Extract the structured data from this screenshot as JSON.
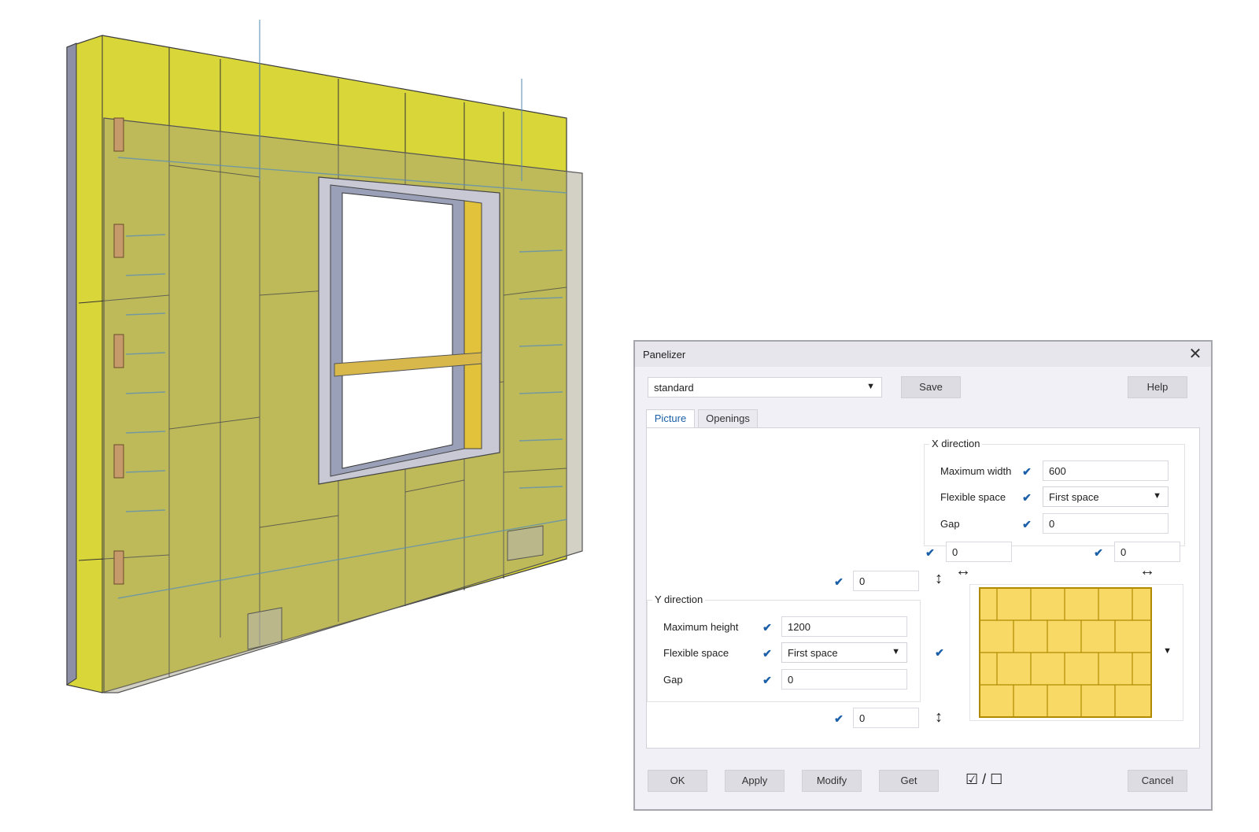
{
  "dialog": {
    "title": "Panelizer",
    "close_icon": "close-icon",
    "preset_value": "standard",
    "save_label": "Save",
    "help_label": "Help",
    "tabs": [
      {
        "label": "Picture",
        "active": true
      },
      {
        "label": "Openings",
        "active": false
      }
    ],
    "x_direction": {
      "title": "X direction",
      "max_width_label": "Maximum width",
      "max_width_value": "600",
      "flexible_label": "Flexible space",
      "flexible_value": "First space",
      "gap_label": "Gap",
      "gap_value": "0"
    },
    "y_direction": {
      "title": "Y direction",
      "max_height_label": "Maximum height",
      "max_height_value": "1200",
      "flexible_label": "Flexible space",
      "flexible_value": "First space",
      "gap_label": "Gap",
      "gap_value": "0"
    },
    "offsets": {
      "left_x": "0",
      "right_x": "0",
      "top_y": "0",
      "bottom_y": "0"
    },
    "buttons": {
      "ok": "OK",
      "apply": "Apply",
      "modify": "Modify",
      "get": "Get",
      "toggle": "☑ / ☐",
      "cancel": "Cancel"
    },
    "colors": {
      "panel_fill": "#f9d966",
      "panel_border": "#b08a00",
      "accent": "#1a5fa8"
    }
  }
}
